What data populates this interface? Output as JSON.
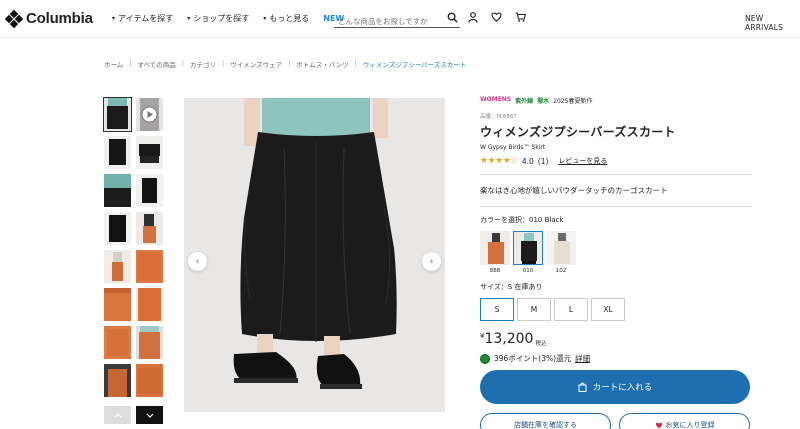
{
  "header": {
    "logo_text": "Columbia",
    "nav": [
      {
        "label": "アイテムを探す"
      },
      {
        "label": "ショップを探す"
      },
      {
        "label": "もっと見る"
      }
    ],
    "nav_new": "NEW",
    "search_placeholder": "どんな商品をお探しですか",
    "new_arrivals": "NEW ARRIVALS"
  },
  "breadcrumb": [
    "ホーム",
    "すべての商品",
    "カテゴリ",
    "ウイメンズウェア",
    "ボトムス・パンツ",
    "ウィメンズジプシーバーズスカート"
  ],
  "product": {
    "tags": {
      "womens": "WOMENS",
      "uv": "紫外線",
      "water": "撥水",
      "season": "2025春夏新作"
    },
    "sku": "品番：PL6867",
    "title": "ウィメンズジプシーバーズスカート",
    "subtitle": "W Gypsy Birds™ Skirt",
    "rating": "4.0",
    "review_count": "(1)",
    "review_link": "レビューを見る",
    "catch_copy": "楽なはき心地が嬉しいパウダータッチのカーゴスカート",
    "color_label": "カラーを選択：010 Black",
    "colors": [
      {
        "code": "888",
        "hex": "#d2713c"
      },
      {
        "code": "010",
        "hex": "#1c1c1c"
      },
      {
        "code": "102",
        "hex": "#ece6da"
      }
    ],
    "size_label": "サイズ：S  在庫あり",
    "sizes": [
      "S",
      "M",
      "L",
      "XL"
    ],
    "price_symbol": "¥",
    "price": "13,200",
    "price_tax": "税込",
    "points": "396ポイント(3%)還元",
    "points_link": "詳細",
    "cart_button": "カートに入れる",
    "store_button": "店舗在庫を確認する",
    "wishlist_button": "お気に入り登録"
  },
  "colors": {
    "accent": "#1d6fb0",
    "link": "#1a7fc1",
    "rating": "#e2a82a"
  }
}
